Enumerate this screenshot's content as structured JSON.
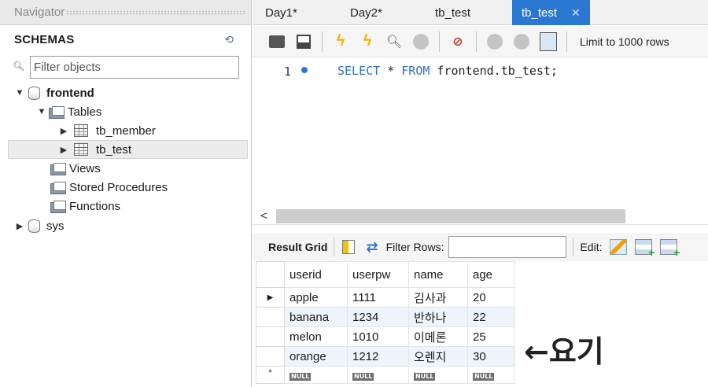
{
  "navigator": {
    "header": "Navigator",
    "schemas_title": "SCHEMAS",
    "filter_placeholder": "Filter objects",
    "tree": {
      "schema1": "frontend",
      "tables_folder": "Tables",
      "table1": "tb_member",
      "table2": "tb_test",
      "views_folder": "Views",
      "procedures_folder": "Stored Procedures",
      "functions_folder": "Functions",
      "schema2": "sys"
    }
  },
  "tabs": [
    {
      "label": "Day1*"
    },
    {
      "label": "Day2*"
    },
    {
      "label": "tb_test"
    },
    {
      "label": "tb_test",
      "active": true
    }
  ],
  "toolbar": {
    "limit_label": "Limit to 1000 rows"
  },
  "editor": {
    "line_number": "1",
    "sql": {
      "kw1": "SELECT",
      "star": " * ",
      "kw2": "FROM",
      "rest": " frontend.tb_test;"
    }
  },
  "result": {
    "grid_label": "Result Grid",
    "filter_rows_label": "Filter Rows:",
    "edit_label": "Edit:",
    "columns": [
      "userid",
      "userpw",
      "name",
      "age"
    ],
    "rows": [
      [
        "apple",
        "1111",
        "김사과",
        "20"
      ],
      [
        "banana",
        "1234",
        "반하나",
        "22"
      ],
      [
        "melon",
        "1010",
        "이메론",
        "25"
      ],
      [
        "orange",
        "1212",
        "오렌지",
        "30"
      ]
    ],
    "null_label": "NULL",
    "current_row_marker": "▶",
    "new_row_marker": "*"
  },
  "annotation": "←요기",
  "colors": {
    "accent": "#2b78d2",
    "keyword": "#2f6fc6",
    "alt_row": "#eef4fb"
  }
}
